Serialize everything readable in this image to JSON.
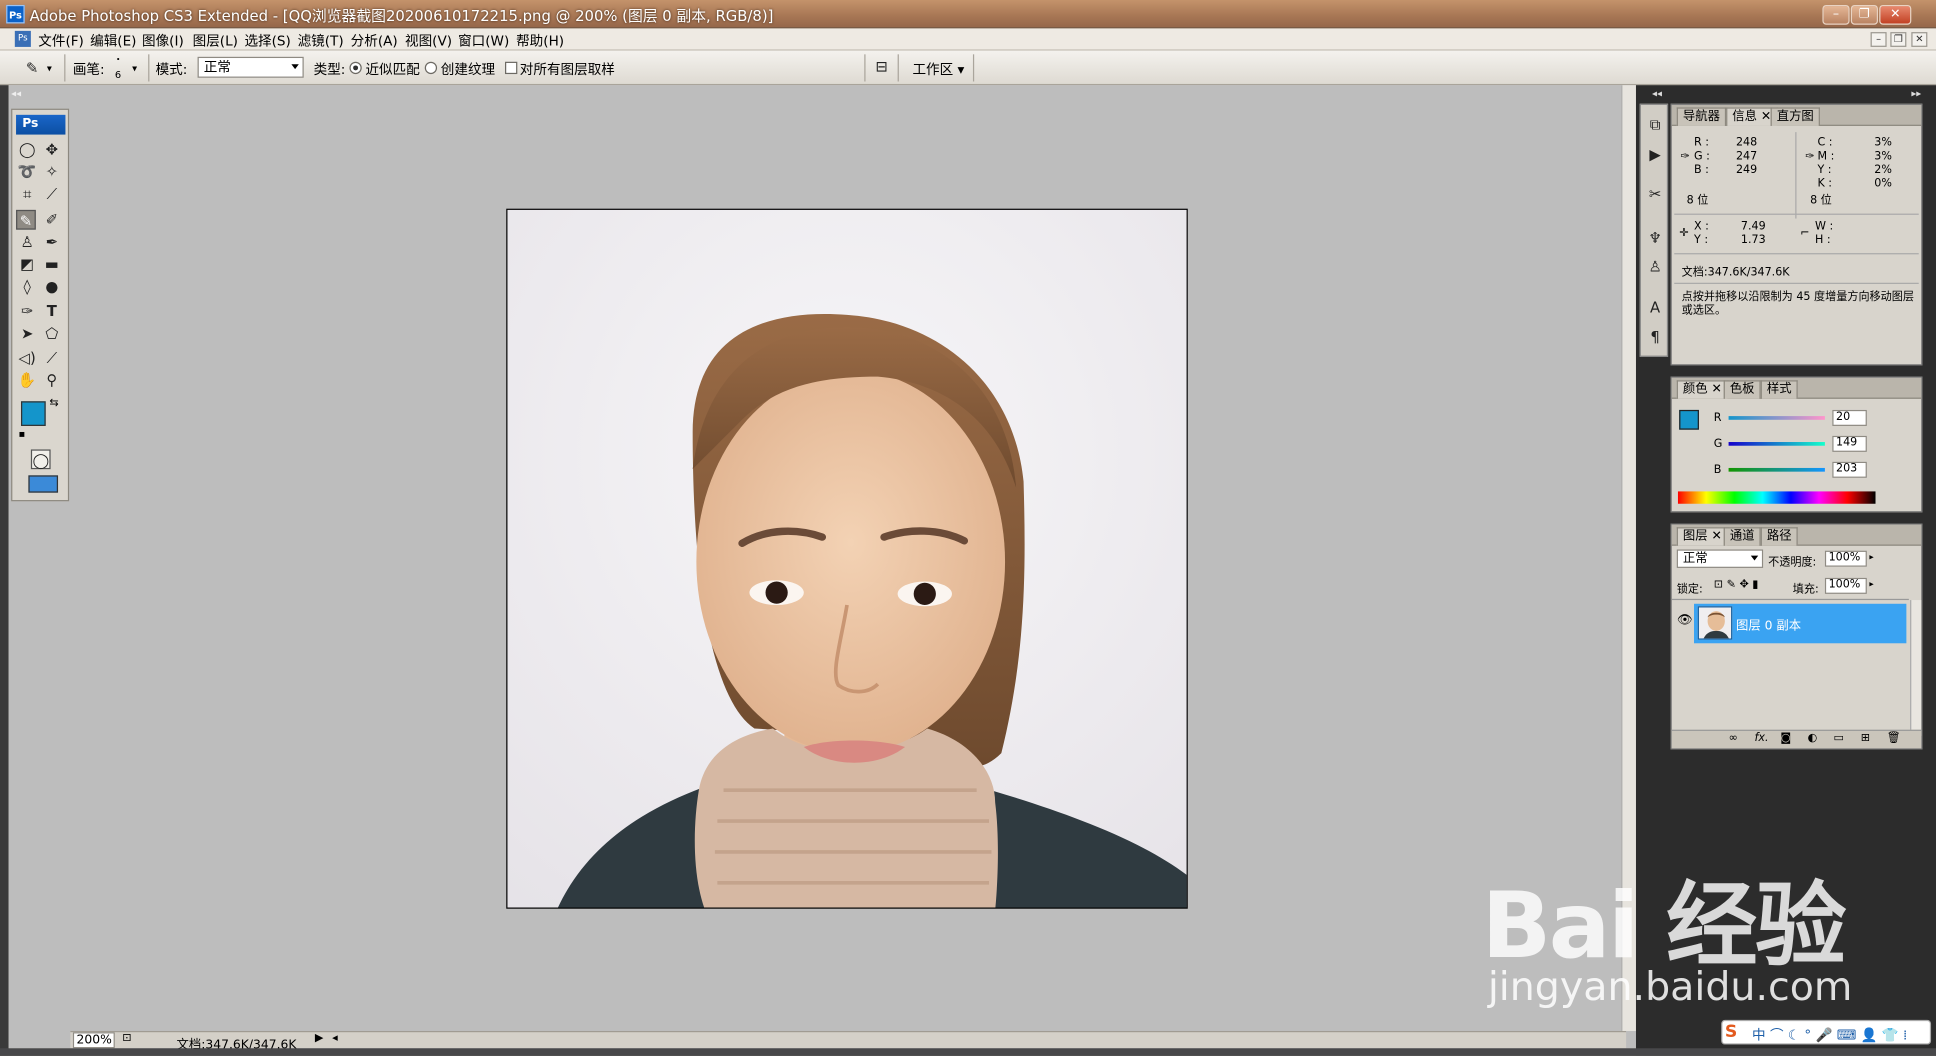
{
  "titlebar": {
    "title": "Adobe Photoshop CS3 Extended - [QQ浏览器截图20200610172215.png @ 200% (图层 0 副本, RGB/8)]"
  },
  "menu": {
    "items": [
      "文件(F)",
      "编辑(E)",
      "图像(I)",
      "图层(L)",
      "选择(S)",
      "滤镜(T)",
      "分析(A)",
      "视图(V)",
      "窗口(W)",
      "帮助(H)"
    ]
  },
  "options": {
    "brush_label": "画笔:",
    "brush_size": "6",
    "mode_label": "模式:",
    "mode_value": "正常",
    "type_label": "类型:",
    "type_opt1": "近似匹配",
    "type_opt2": "创建纹理",
    "sample_all": "对所有图层取样",
    "workspace": "工作区 ▾"
  },
  "toolbox": {
    "logo": "Ps"
  },
  "status": {
    "zoom": "200%",
    "doc": "文档:347.6K/347.6K"
  },
  "info_panel": {
    "tabs": [
      "导航器",
      "信息",
      "直方图"
    ],
    "r_label": "R :",
    "r": "248",
    "g_label": "G :",
    "g": "247",
    "b_label": "B :",
    "b": "249",
    "c_label": "C :",
    "c": "3%",
    "m_label": "M :",
    "m": "3%",
    "y_label": "Y :",
    "y": "2%",
    "k_label": "K :",
    "k": "0%",
    "bits1": "8 位",
    "bits2": "8 位",
    "x_label": "X :",
    "x": "7.49",
    "y2_label": "Y :",
    "y2": "1.73",
    "w_label": "W :",
    "h_label": "H :",
    "doc": "文档:347.6K/347.6K",
    "hint": "点按并拖移以沿限制为 45 度增量方向移动图层或选区。"
  },
  "color_panel": {
    "tabs": [
      "颜色",
      "色板",
      "样式"
    ],
    "r_label": "R",
    "r": "20",
    "g_label": "G",
    "g": "149",
    "b_label": "B",
    "b": "203",
    "fg_color": "#1495cb"
  },
  "layers_panel": {
    "tabs": [
      "图层",
      "通道",
      "路径"
    ],
    "blend": "正常",
    "opacity_label": "不透明度:",
    "opacity": "100%",
    "lock_label": "锁定:",
    "fill_label": "填充:",
    "fill": "100%",
    "layer_name": "图层 0 副本"
  },
  "watermark": {
    "brand": "Bai 经验",
    "url": "jingyan.baidu.com"
  },
  "ime": {
    "logo": "S",
    "label": "中 ⌒ ☾ ° 🎤 ⌨ 👤 👕 ⁞"
  }
}
